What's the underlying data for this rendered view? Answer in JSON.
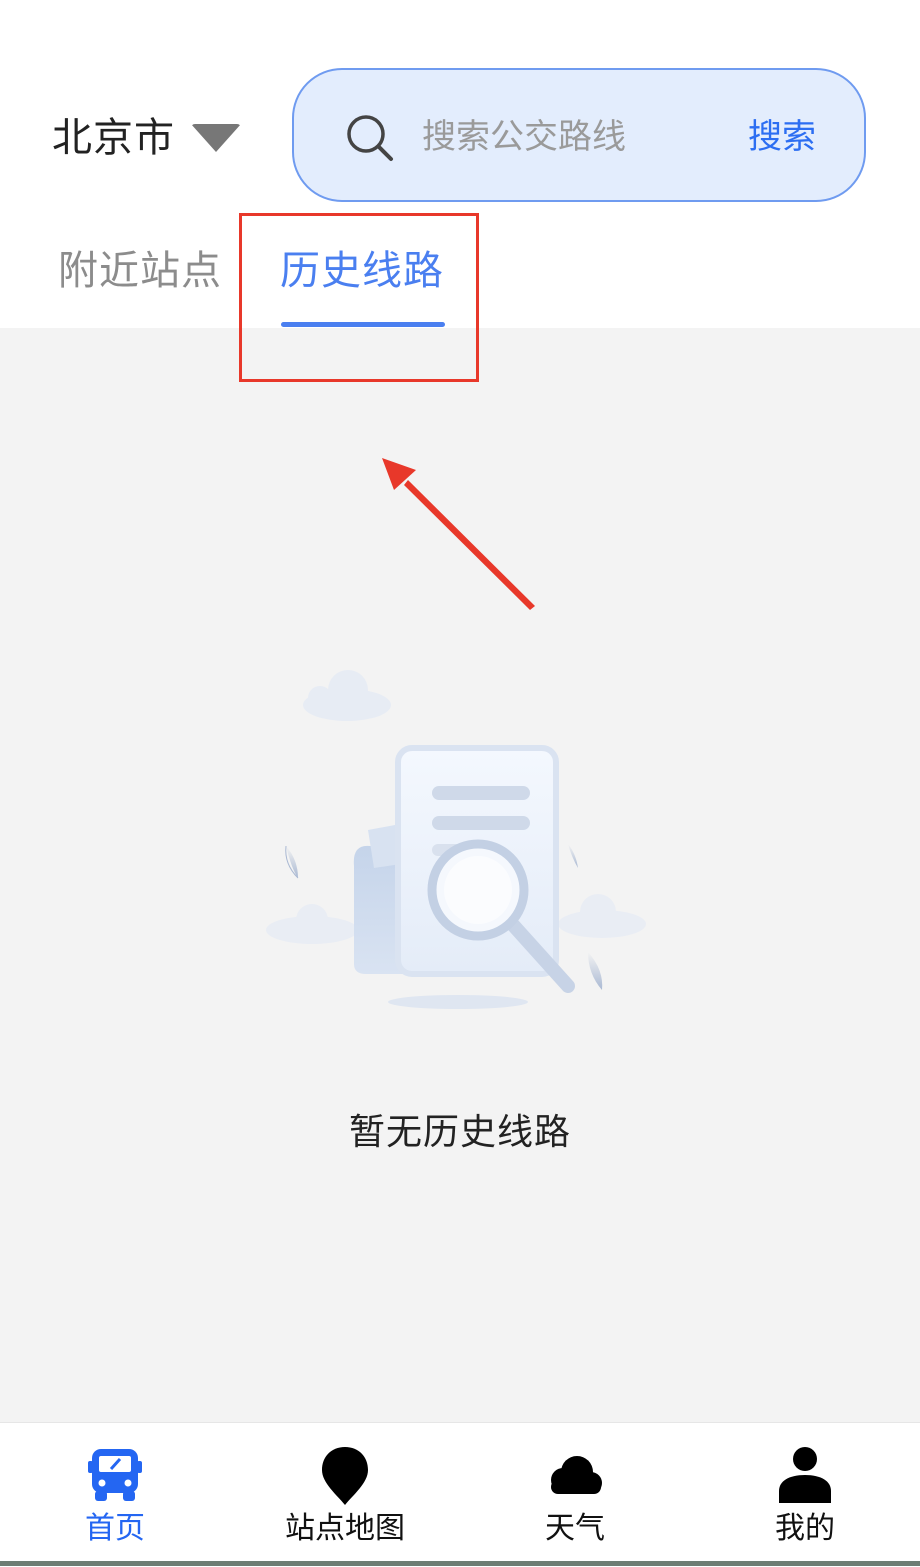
{
  "header": {
    "city": "北京市",
    "search": {
      "placeholder": "搜索公交路线",
      "button_label": "搜索"
    }
  },
  "tabs": [
    {
      "label": "附近站点",
      "active": false
    },
    {
      "label": "历史线路",
      "active": true
    }
  ],
  "main": {
    "empty_message": "暂无历史线路"
  },
  "bottom_nav": [
    {
      "label": "首页",
      "icon": "bus-icon",
      "active": true
    },
    {
      "label": "站点地图",
      "icon": "location-pin-icon",
      "active": false
    },
    {
      "label": "天气",
      "icon": "cloud-icon",
      "active": false
    },
    {
      "label": "我的",
      "icon": "user-icon",
      "active": false
    }
  ],
  "colors": {
    "accent": "#4a7ff0",
    "search_bg": "#e3edfd",
    "search_border": "#6f9bf0",
    "annotation": "#e8382a",
    "content_bg": "#f3f3f3"
  }
}
